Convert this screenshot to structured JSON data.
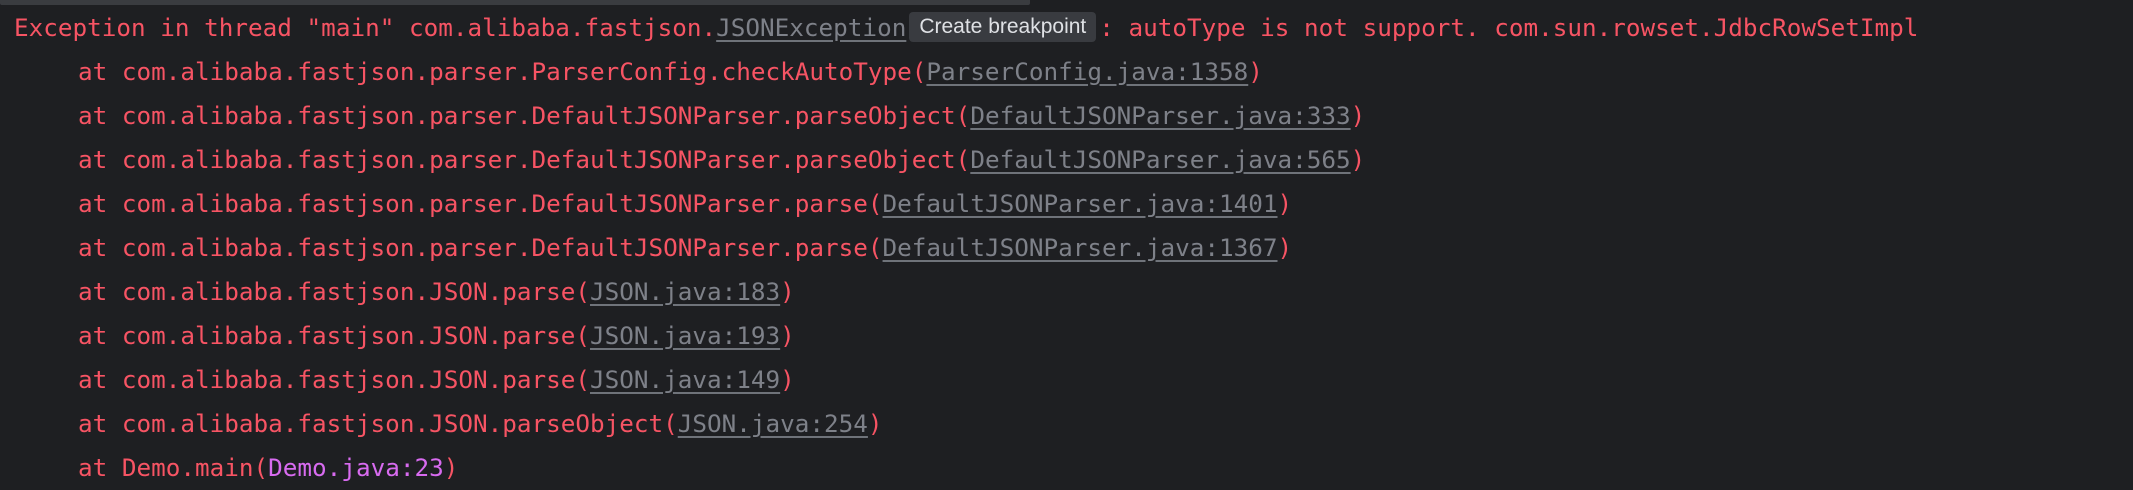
{
  "exception": {
    "prefix": "Exception in thread \"main\" com.alibaba.fastjson.",
    "class_link": "JSONException",
    "tooltip": "Create breakpoint",
    "message": ": autoType is not support. com.sun.rowset.JdbcRowSetImpl"
  },
  "frames": [
    {
      "prefix": "at com.alibaba.fastjson.parser.ParserConfig.checkAutoType(",
      "link": "ParserConfig.java:1358",
      "suffix": ")"
    },
    {
      "prefix": "at com.alibaba.fastjson.parser.DefaultJSONParser.parseObject(",
      "link": "DefaultJSONParser.java:333",
      "suffix": ")"
    },
    {
      "prefix": "at com.alibaba.fastjson.parser.DefaultJSONParser.parseObject(",
      "link": "DefaultJSONParser.java:565",
      "suffix": ")"
    },
    {
      "prefix": "at com.alibaba.fastjson.parser.DefaultJSONParser.parse(",
      "link": "DefaultJSONParser.java:1401",
      "suffix": ")"
    },
    {
      "prefix": "at com.alibaba.fastjson.parser.DefaultJSONParser.parse(",
      "link": "DefaultJSONParser.java:1367",
      "suffix": ")"
    },
    {
      "prefix": "at com.alibaba.fastjson.JSON.parse(",
      "link": "JSON.java:183",
      "suffix": ")"
    },
    {
      "prefix": "at com.alibaba.fastjson.JSON.parse(",
      "link": "JSON.java:193",
      "suffix": ")"
    },
    {
      "prefix": "at com.alibaba.fastjson.JSON.parse(",
      "link": "JSON.java:149",
      "suffix": ")"
    },
    {
      "prefix": "at com.alibaba.fastjson.JSON.parseObject(",
      "link": "JSON.java:254",
      "suffix": ")"
    },
    {
      "prefix": "at Demo.main(",
      "link": "Demo.java:23",
      "suffix": ")"
    }
  ],
  "colors": {
    "background": "#1e1f22",
    "error_text": "#f75464",
    "library_link": "#7e8189",
    "user_code_link": "#d86bf0",
    "tooltip_bg": "#393b40",
    "tooltip_text": "#dfe1e5"
  }
}
